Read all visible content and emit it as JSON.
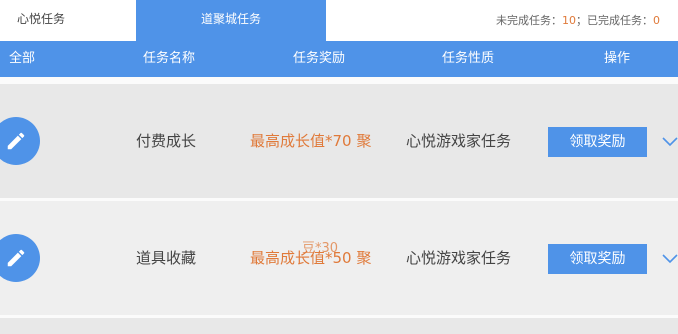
{
  "tabs": [
    {
      "label": "心悦任务"
    },
    {
      "label": "道聚城任务"
    }
  ],
  "summary": {
    "incomplete_label": "未完成任务：",
    "incomplete_count": "10",
    "separator": "；",
    "complete_label": "已完成任务：",
    "complete_count": "0"
  },
  "table": {
    "headers": [
      "全部",
      "任务名称",
      "任务奖励",
      "任务性质",
      "操作"
    ],
    "rows": [
      {
        "name": "付费成长",
        "reward": "最高成长值*70 聚",
        "nature": "心悦游戏家任务",
        "action": "领取奖励",
        "overlay": ""
      },
      {
        "name": "道具收藏",
        "reward": "最高成长值*50 聚",
        "nature": "心悦游戏家任务",
        "action": "领取奖励",
        "overlay": "豆*30"
      }
    ]
  },
  "colors": {
    "accent": "#4f93e8",
    "highlight": "#e07a3a",
    "row_bg": "#e8e8e8"
  },
  "icons": {
    "row_icon": "pencil-icon",
    "expand_icon": "chevron-down-icon"
  }
}
